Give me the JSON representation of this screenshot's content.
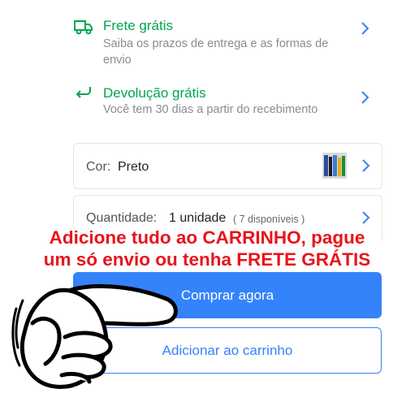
{
  "shipping": {
    "title": "Frete grátis",
    "subtitle_line1": "Saiba os prazos de entrega e as formas de",
    "subtitle_line2": "envio",
    "icon": "truck-icon"
  },
  "returns": {
    "title": "Devolução grátis",
    "subtitle": "Você tem 30 dias a partir do recebimento",
    "icon": "return-arrow-icon"
  },
  "color_selector": {
    "label": "Cor:",
    "value": "Preto",
    "thumbnail": "product-thumbnail"
  },
  "quantity_selector": {
    "label": "Quantidade:",
    "value": "1 unidade",
    "available": "( 7 disponíveis )"
  },
  "promo": {
    "line1": "Adicione tudo ao CARRINHO, pague",
    "line2": "um só envio ou tenha FRETE GRÁTIS"
  },
  "buttons": {
    "buy_now": "Comprar agora",
    "add_to_cart": "Adicionar ao carrinho"
  },
  "colors": {
    "green": "#00a650",
    "blue": "#3483fa",
    "promo_red": "#e8141b"
  }
}
